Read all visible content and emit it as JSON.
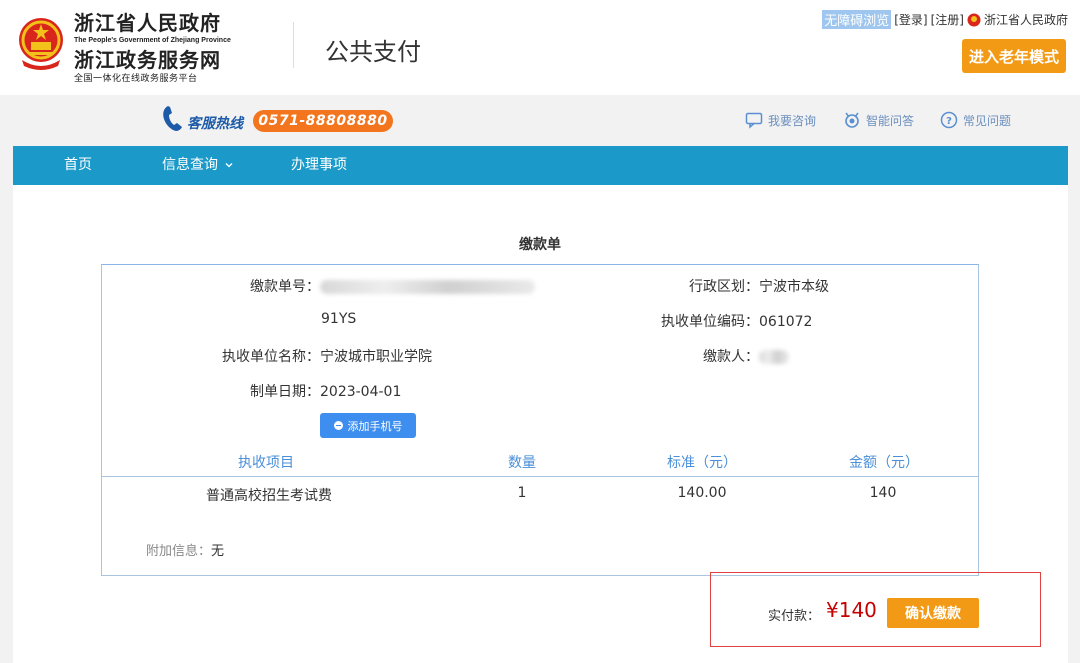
{
  "header": {
    "brand_cn": "浙江省人民政府",
    "brand_en": "The People's Government of Zhejiang Province",
    "brand_cn2": "浙江政务服务网",
    "brand_sub": "全国一体化在线政务服务平台",
    "title": "公共支付",
    "top_links": {
      "accessibility": "无障碍浏览",
      "login": "[登录]",
      "register": "[注册]",
      "gov": "浙江省人民政府"
    },
    "elder_mode": "进入老年模式"
  },
  "service": {
    "hotline_label": "客服热线",
    "hotline_number": "0571-88808880",
    "links": {
      "consult": "我要咨询",
      "smart_qa": "智能问答",
      "faq": "常见问题"
    }
  },
  "nav": {
    "home": "首页",
    "info_query": "信息查询",
    "affairs": "办理事项"
  },
  "bill": {
    "title": "缴款单",
    "bill_no_label": "缴款单号：",
    "bill_no_suffix": "91YS",
    "region_label": "行政区划：",
    "region_value": "宁波市本级",
    "unit_code_label": "执收单位编码：",
    "unit_code_value": "061072",
    "unit_name_label": "执收单位名称：",
    "unit_name_value": "宁波城市职业学院",
    "payer_label": "缴款人：",
    "date_label": "制单日期：",
    "date_value": "2023-04-01",
    "add_phone": "添加手机号",
    "columns": {
      "item": "执收项目",
      "qty": "数量",
      "std": "标准（元）",
      "amount": "金额（元）"
    },
    "rows": [
      {
        "item": "普通高校招生考试费",
        "qty": "1",
        "std": "140.00",
        "amount": "140"
      }
    ],
    "extra_label": "附加信息：",
    "extra_value": "无"
  },
  "payment": {
    "label": "实付款：",
    "amount": "¥140",
    "confirm": "确认缴款"
  },
  "colors": {
    "nav_bg": "#1b9ac9",
    "accent_orange": "#f29a16",
    "hotline_orange": "#f3751e",
    "amount_red": "#c40000",
    "table_header_blue": "#4a8fd8"
  }
}
